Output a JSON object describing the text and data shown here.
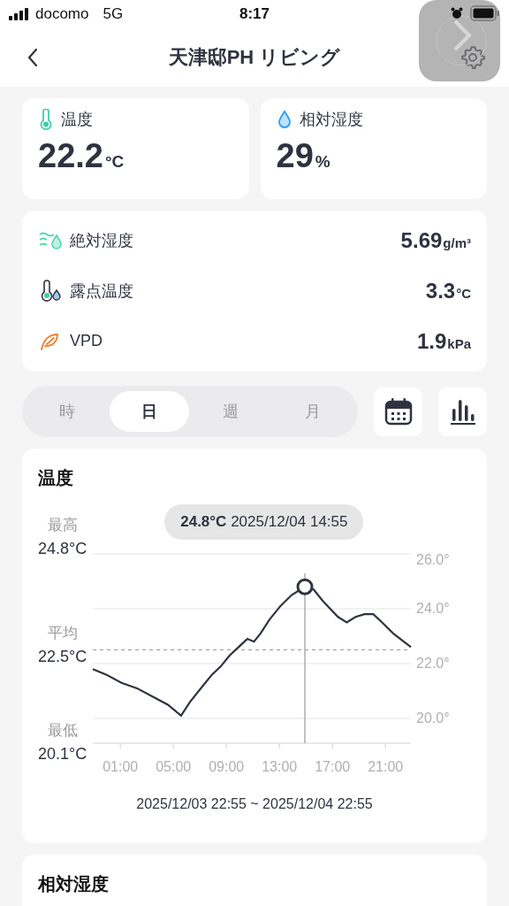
{
  "status_bar": {
    "carrier": "docomo",
    "network": "5G",
    "time": "8:17"
  },
  "header": {
    "title": "天津邸PH リビング"
  },
  "main_cards": [
    {
      "kind": "thermo",
      "label": "温度",
      "value": "22.2",
      "unit": "°C"
    },
    {
      "kind": "drop",
      "label": "相対湿度",
      "value": "29",
      "unit": "%"
    }
  ],
  "details": [
    {
      "kind": "abs",
      "label": "絶対湿度",
      "value": "5.69",
      "unit": "g/m³"
    },
    {
      "kind": "dew",
      "label": "露点温度",
      "value": "3.3",
      "unit": "°C"
    },
    {
      "kind": "leaf",
      "label": "VPD",
      "value": "1.9",
      "unit": "kPa"
    }
  ],
  "periods": [
    {
      "label": "時",
      "selected": false
    },
    {
      "label": "日",
      "selected": true
    },
    {
      "label": "週",
      "selected": false
    },
    {
      "label": "月",
      "selected": false
    }
  ],
  "chart_card": {
    "title": "温度",
    "summary": [
      {
        "label": "最高",
        "value": "24.8°C"
      },
      {
        "label": "平均",
        "value": "22.5°C"
      },
      {
        "label": "最低",
        "value": "20.1°C"
      }
    ],
    "tooltip": {
      "value": "24.8°C",
      "time": "2025/12/04 14:55"
    },
    "chart_data": {
      "type": "line",
      "grid": true,
      "xlim": [
        -1.08,
        22.92
      ],
      "ylim": [
        19.1,
        26
      ],
      "yticks": [
        {
          "value": 20,
          "label": "20.0°"
        },
        {
          "value": 22,
          "label": "22.0°"
        },
        {
          "value": 24,
          "label": "24.0°"
        },
        {
          "value": 26,
          "label": "26.0°"
        }
      ],
      "xticks": [
        {
          "value": 1,
          "label": "01:00"
        },
        {
          "value": 5,
          "label": "05:00"
        },
        {
          "value": 9,
          "label": "09:00"
        },
        {
          "value": 13,
          "label": "13:00"
        },
        {
          "value": 17,
          "label": "17:00"
        },
        {
          "value": 21,
          "label": "21:00"
        }
      ],
      "x": [
        -1.08,
        -0.08,
        1.08,
        2.25,
        3.42,
        4.58,
        5.58,
        6.25,
        7.25,
        7.92,
        8.58,
        9.25,
        9.92,
        10.58,
        11.08,
        11.58,
        12.25,
        13.08,
        13.92,
        14.92,
        15.58,
        16.25,
        16.83,
        17.42,
        18.08,
        18.75,
        19.42,
        20.08,
        20.75,
        21.58,
        22.92
      ],
      "series": [
        {
          "color": "#2f3340",
          "values": [
            21.8,
            21.6,
            21.3,
            21.1,
            20.8,
            20.5,
            20.1,
            20.6,
            21.2,
            21.6,
            21.9,
            22.3,
            22.6,
            22.9,
            22.8,
            23.1,
            23.6,
            24.1,
            24.5,
            24.8,
            24.7,
            24.3,
            24.0,
            23.7,
            23.5,
            23.7,
            23.8,
            23.8,
            23.5,
            23.1,
            22.6
          ]
        }
      ],
      "ref_lines": [
        {
          "axis": "y",
          "value": 22.5
        },
        {
          "axis": "x",
          "value": 14.92
        }
      ]
    },
    "range": "2025/12/03 22:55 ~ 2025/12/04 22:55"
  },
  "next_card": {
    "title": "相対湿度"
  }
}
